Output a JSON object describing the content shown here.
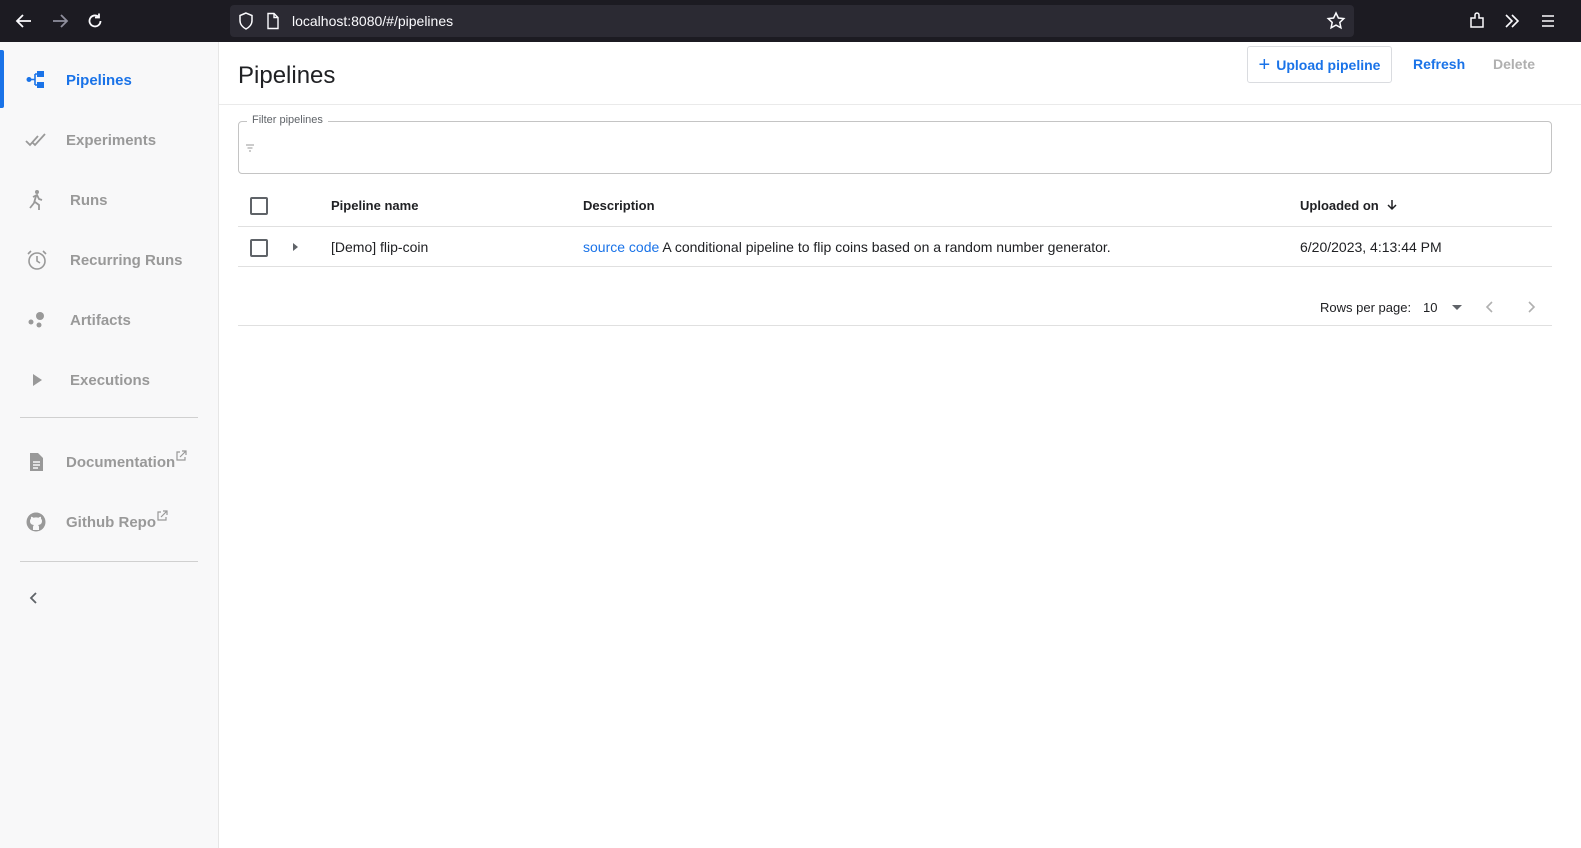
{
  "browser": {
    "url": "localhost:8080/#/pipelines"
  },
  "sidebar": {
    "items": [
      {
        "label": "Pipelines",
        "icon": "pipelines-icon",
        "active": true
      },
      {
        "label": "Experiments",
        "icon": "experiments-icon"
      },
      {
        "label": "Runs",
        "icon": "runs-icon"
      },
      {
        "label": "Recurring Runs",
        "icon": "recurring-runs-icon"
      },
      {
        "label": "Artifacts",
        "icon": "artifacts-icon"
      },
      {
        "label": "Executions",
        "icon": "executions-icon"
      }
    ],
    "links": [
      {
        "label": "Documentation",
        "icon": "document-icon"
      },
      {
        "label": "Github Repo",
        "icon": "github-icon"
      }
    ]
  },
  "header": {
    "title": "Pipelines",
    "upload_label": "Upload pipeline",
    "refresh_label": "Refresh",
    "delete_label": "Delete"
  },
  "filter": {
    "label": "Filter pipelines",
    "value": ""
  },
  "table": {
    "columns": [
      "Pipeline name",
      "Description",
      "Uploaded on"
    ],
    "sort_column": "Uploaded on",
    "rows": [
      {
        "name": "[Demo] flip-coin",
        "description_link": "source code",
        "description": "A conditional pipeline to flip coins based on a random number generator.",
        "uploaded_on": "6/20/2023, 4:13:44 PM"
      }
    ]
  },
  "pagination": {
    "rows_per_page_label": "Rows per page:",
    "rows_per_page": "10"
  },
  "colors": {
    "accent": "#1a73e8",
    "inactive": "#999999"
  }
}
